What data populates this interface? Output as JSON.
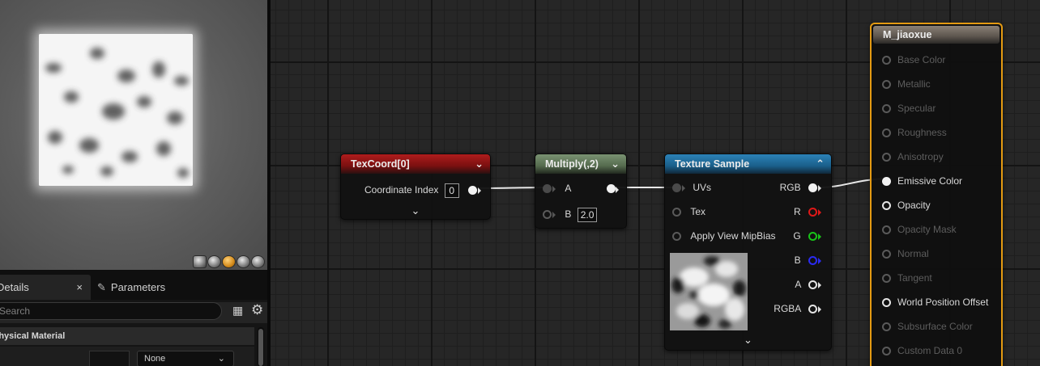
{
  "viewport": {
    "preview_shapes": [
      "cylinder-icon",
      "sphere-icon",
      "plane-icon",
      "cube-icon",
      "teapot-icon"
    ],
    "active_shape_index": 2
  },
  "details_panel": {
    "tabs": [
      {
        "label": "Details",
        "close": "×"
      },
      {
        "label": "Parameters"
      }
    ],
    "search_placeholder": "Search",
    "section_title": "Physical Material",
    "property_select": "None"
  },
  "nodes": {
    "texcoord": {
      "title": "TexCoord[0]",
      "chevron": "⌄",
      "pin_label": "Coordinate Index",
      "value": "0"
    },
    "multiply": {
      "title": "Multiply(,2)",
      "chevron": "⌄",
      "inputs": [
        "A",
        "B"
      ],
      "b_value": "2.0"
    },
    "texture_sample": {
      "title": "Texture Sample",
      "chevron": "⌃",
      "inputs": [
        "UVs",
        "Tex",
        "Apply View MipBias"
      ],
      "outputs": [
        "RGB",
        "R",
        "G",
        "B",
        "A",
        "RGBA"
      ]
    },
    "result": {
      "title": "M_jiaoxue",
      "pins": [
        {
          "label": "Base Color",
          "active": false
        },
        {
          "label": "Metallic",
          "active": false
        },
        {
          "label": "Specular",
          "active": false
        },
        {
          "label": "Roughness",
          "active": false
        },
        {
          "label": "Anisotropy",
          "active": false
        },
        {
          "label": "Emissive Color",
          "active": true,
          "connected": true
        },
        {
          "label": "Opacity",
          "active": true,
          "connected": false
        },
        {
          "label": "Opacity Mask",
          "active": false
        },
        {
          "label": "Normal",
          "active": false
        },
        {
          "label": "Tangent",
          "active": false
        },
        {
          "label": "World Position Offset",
          "active": true,
          "connected": false
        },
        {
          "label": "Subsurface Color",
          "active": false
        },
        {
          "label": "Custom Data 0",
          "active": false
        }
      ]
    }
  },
  "colors": {
    "texcoord_header": "#b01c1c",
    "multiply_header": "#7a9272",
    "texture_sample_header": "#2c82b8",
    "result_border": "#e49a12",
    "pin_r": "#e01818",
    "pin_g": "#18c418",
    "pin_b": "#2b2bf2"
  }
}
